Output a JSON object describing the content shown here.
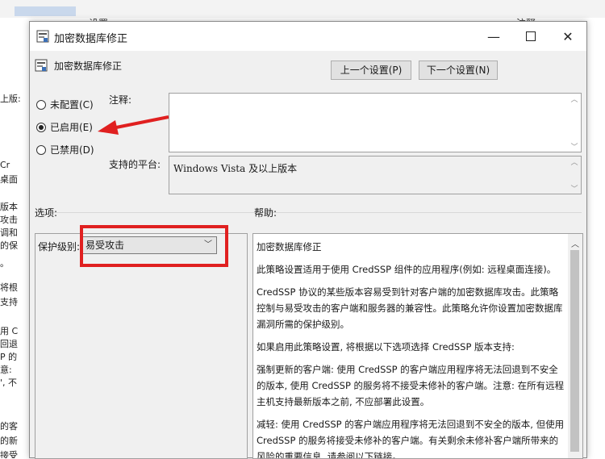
{
  "background": {
    "top_texts": [
      "设置",
      "注释"
    ],
    "left_fragments": [
      "上版:",
      "Cr",
      "桌面",
      "版本",
      "攻击",
      "调和",
      "的保",
      "。",
      "将根",
      "支持",
      "用 C",
      "回退",
      "P 的",
      "意:",
      "', 不",
      "的客",
      "的新",
      "接受"
    ]
  },
  "dialog": {
    "title": "加密数据库修正",
    "subtitle": "加密数据库修正",
    "prev_button": "上一个设置(P)",
    "next_button": "下一个设置(N)",
    "radio_not_configured": "未配置(C)",
    "radio_enabled": "已启用(E)",
    "radio_disabled": "已禁用(D)",
    "comment_label": "注释:",
    "platform_label": "支持的平台:",
    "platform_value": "Windows Vista 及以上版本",
    "options_label": "选项:",
    "help_label": "帮助:",
    "protection_label": "保护级别:",
    "protection_value": "易受攻击",
    "help_paragraphs": [
      "加密数据库修正",
      "此策略设置适用于使用 CredSSP 组件的应用程序(例如: 远程桌面连接)。",
      "CredSSP 协议的某些版本容易受到针对客户端的加密数据库攻击。此策略控制与易受攻击的客户端和服务器的兼容性。此策略允许你设置加密数据库漏洞所需的保护级别。",
      "如果启用此策略设置, 将根据以下选项选择 CredSSP 版本支持:",
      "强制更新的客户端: 使用 CredSSP 的客户端应用程序将无法回退到不安全的版本, 使用 CredSSP 的服务将不接受未修补的客户端。注意: 在所有远程主机支持最新版本之前, 不应部署此设置。",
      "减轻: 使用 CredSSP 的客户端应用程序将无法回退到不安全的版本, 但使用 CredSSP 的服务将接受未修补的客户端。有关剩余未修补客户端所带来的风险的重要信息, 请参阅以下链接。"
    ]
  },
  "colors": {
    "annotation_red": "#e02020",
    "dialog_bg": "#f0f0f0"
  },
  "icons": [
    "policy-icon",
    "minimize-icon",
    "maximize-icon",
    "close-icon",
    "chevron-down-icon",
    "red-arrow-icon"
  ]
}
